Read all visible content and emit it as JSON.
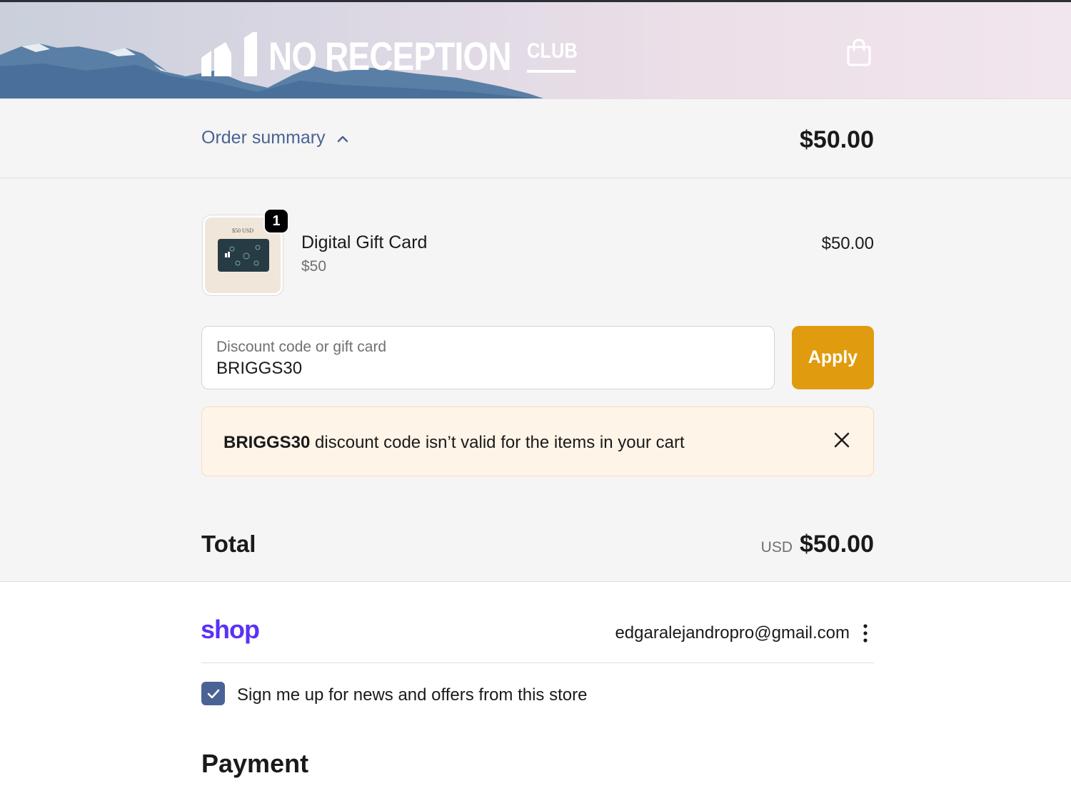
{
  "header": {
    "logo_text": "NO RECEPTION",
    "logo_suffix": "CLUB",
    "cart_icon": "shopping-bag-icon"
  },
  "order_summary": {
    "toggle_label": "Order summary",
    "toggle_icon": "chevron-up-icon",
    "total": "$50.00"
  },
  "line_items": [
    {
      "quantity": "1",
      "name": "Digital Gift Card",
      "variant": "$50",
      "price": "$50.00",
      "thumbnail_label": "$50 USD"
    }
  ],
  "discount": {
    "label": "Discount code or gift card",
    "value": "BRIGGS30",
    "apply_label": "Apply"
  },
  "error": {
    "code": "BRIGGS30",
    "message": " discount code isn’t valid for the items in your cart",
    "close_icon": "close-icon"
  },
  "total": {
    "label": "Total",
    "currency": "USD",
    "amount": "$50.00"
  },
  "express": {
    "shop_label": "shop",
    "email": "edgaralejandropro@gmail.com",
    "more_icon": "more-vertical-icon"
  },
  "newsletter": {
    "checked": true,
    "label": "Sign me up for news and offers from this store"
  },
  "payment": {
    "heading": "Payment"
  },
  "colors": {
    "accent": "#4a6394",
    "apply_button": "#e09c0e",
    "shop_brand": "#5a31f4",
    "error_background": "#fff4e8"
  }
}
